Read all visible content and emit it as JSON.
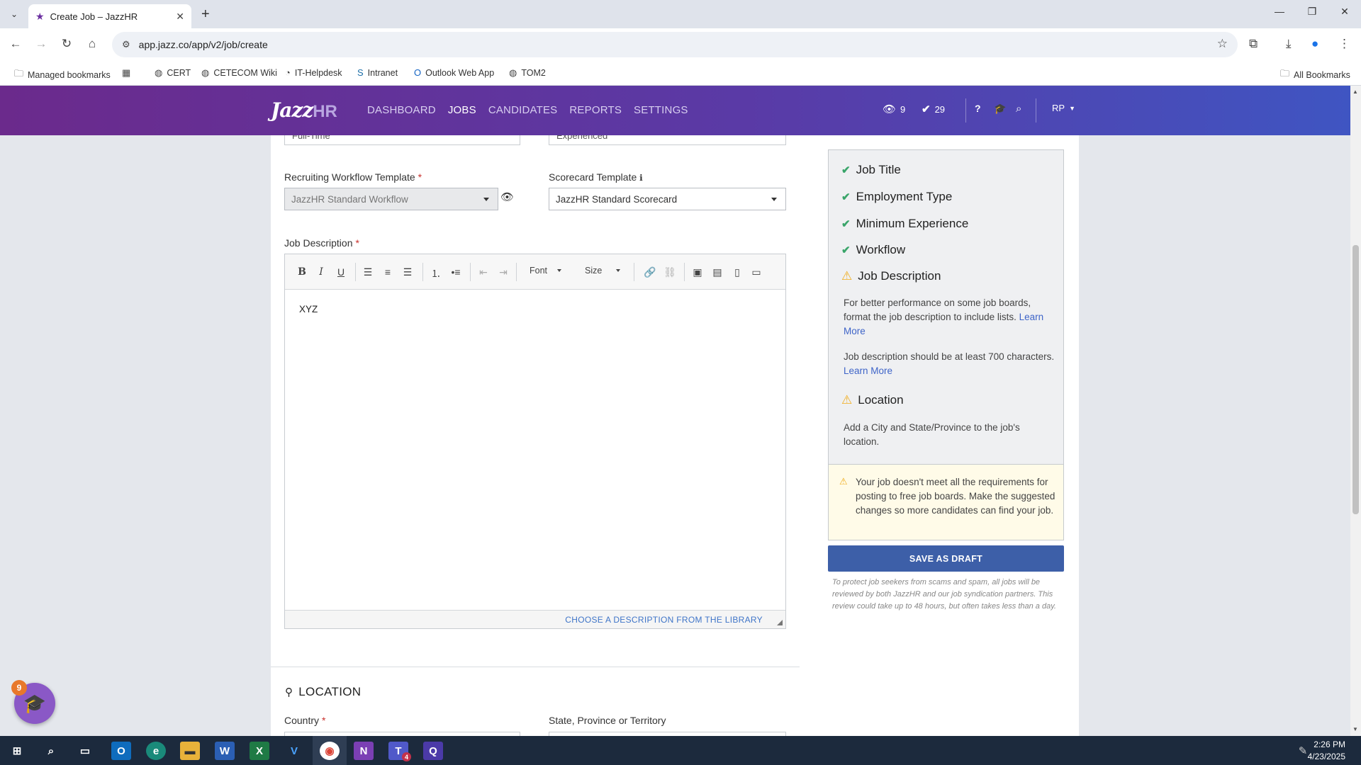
{
  "browser": {
    "tab_title": "Create Job – JazzHR",
    "url": "app.jazz.co/app/v2/job/create",
    "bookmarks": [
      "Managed bookmarks",
      "CERT",
      "CETECOM Wiki",
      "IT-Helpdesk",
      "Intranet",
      "Outlook Web App",
      "TOM2"
    ],
    "all_bookmarks": "All Bookmarks"
  },
  "app": {
    "logo_main": "Jazz",
    "logo_sub": "HR",
    "nav": [
      "DASHBOARD",
      "JOBS",
      "CANDIDATES",
      "REPORTS",
      "SETTINGS"
    ],
    "active_nav": "JOBS",
    "views_count": "9",
    "checks_count": "29",
    "user_initials": "RP"
  },
  "form": {
    "employment_type_value": "Full-Time",
    "experience_value": "Experienced",
    "workflow_label": "Recruiting Workflow Template",
    "workflow_value": "JazzHR Standard Workflow",
    "scorecard_label": "Scorecard Template",
    "scorecard_value": "JazzHR Standard Scorecard",
    "description_label": "Job Description",
    "toolbar_font": "Font",
    "toolbar_size": "Size",
    "description_text": "XYZ",
    "library_link": "CHOOSE A DESCRIPTION FROM THE LIBRARY",
    "location_title": "LOCATION",
    "country_label": "Country",
    "state_label": "State, Province or Territory"
  },
  "requirements": {
    "items": [
      {
        "label": "Job Title",
        "status": "ok"
      },
      {
        "label": "Employment Type",
        "status": "ok"
      },
      {
        "label": "Minimum Experience",
        "status": "ok"
      },
      {
        "label": "Workflow",
        "status": "ok"
      },
      {
        "label": "Job Description",
        "status": "warning"
      },
      {
        "label": "Location",
        "status": "warning"
      }
    ],
    "desc_note1": "For better performance on some job boards, format the job description to include lists.",
    "desc_note2": "Job description should be at least 700 characters.",
    "learn_more": "Learn More",
    "location_note": "Add a City and State/Province to the job's location.",
    "warning_box": "Your job doesn't meet all the requirements for posting to free job boards. Make the suggested changes so more candidates can find your job.",
    "save_draft": "SAVE AS DRAFT",
    "disclaimer": "To protect job seekers from scams and spam, all jobs will be reviewed by both JazzHR and our job syndication partners. This review could take up to 48 hours, but often takes less than a day."
  },
  "help_badge": "9",
  "taskbar": {
    "time": "2:26 PM",
    "date": "4/23/2025",
    "teams_badge": "4"
  },
  "colors": {
    "header_start": "#6b2a8c",
    "header_end": "#3f55c2",
    "primary_button": "#3d5fa8",
    "ok_check": "#3aa56a",
    "warning": "#f0ad1d"
  }
}
